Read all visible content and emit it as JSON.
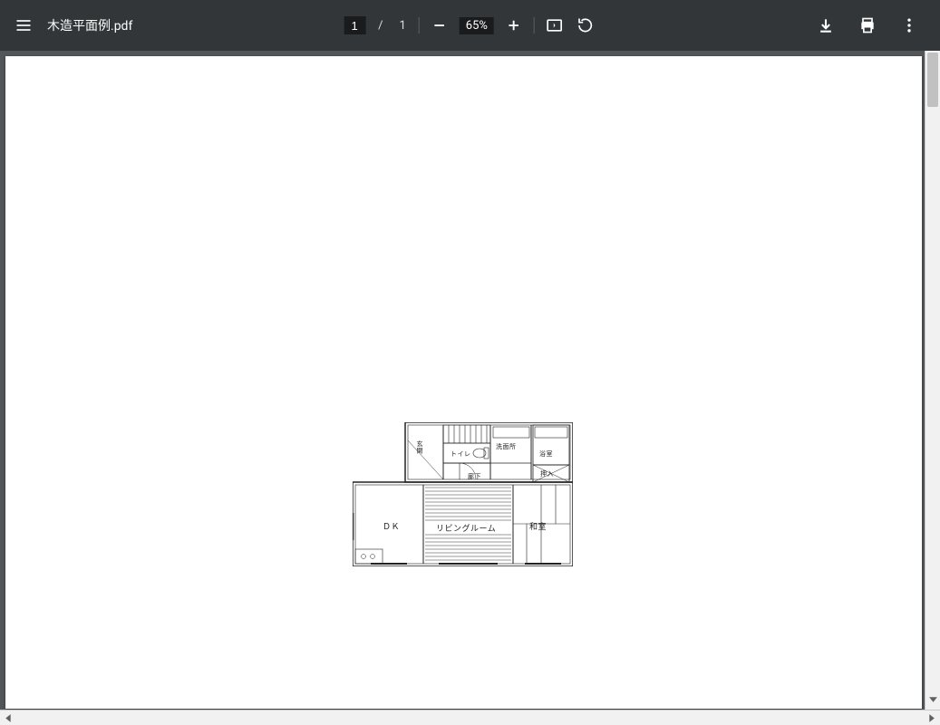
{
  "toolbar": {
    "filename": "木造平面例.pdf",
    "page_current": "1",
    "page_sep": "/",
    "page_total": "1",
    "zoom_level": "65%"
  },
  "floorplan": {
    "rooms": {
      "entrance": "玄関",
      "toilet": "トイレ",
      "washroom": "洗面所",
      "bath": "浴室",
      "closet": "押入",
      "hallway": "廊下",
      "dk": "ＤＫ",
      "living": "リビングルーム",
      "tatami": "和室"
    }
  }
}
